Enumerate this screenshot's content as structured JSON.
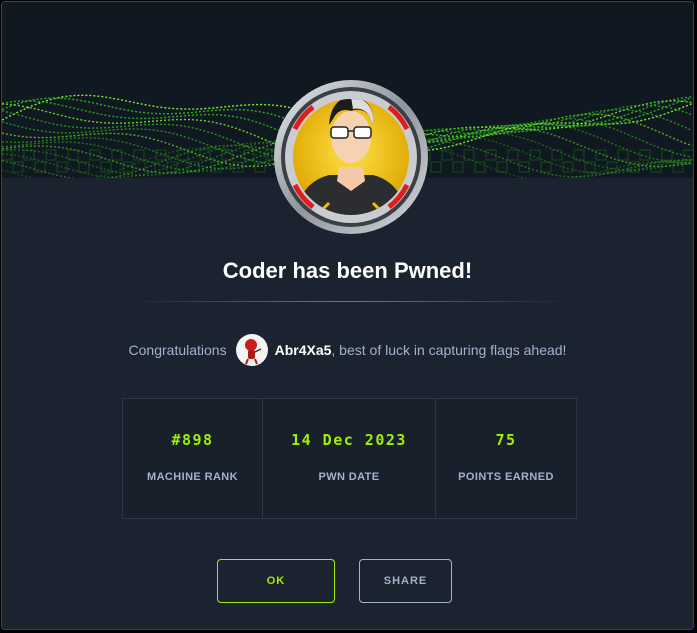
{
  "modal": {
    "title": "Coder has been Pwned!",
    "congrats_prefix": "Congratulations",
    "username": "Abr4Xa5",
    "congrats_suffix": ", best of luck in capturing flags ahead!"
  },
  "stats": [
    {
      "value": "#898",
      "label": "MACHINE RANK"
    },
    {
      "value": "14 Dec 2023",
      "label": "PWN DATE"
    },
    {
      "value": "75",
      "label": "POINTS EARNED"
    }
  ],
  "buttons": {
    "ok": "OK",
    "share": "SHARE"
  },
  "colors": {
    "accent": "#9fef00",
    "background": "#1b2330",
    "muted_text": "#a4b1cd"
  },
  "icons": {
    "machine_avatar": "coder-machine-avatar",
    "user_avatar": "user-avatar-icon"
  }
}
